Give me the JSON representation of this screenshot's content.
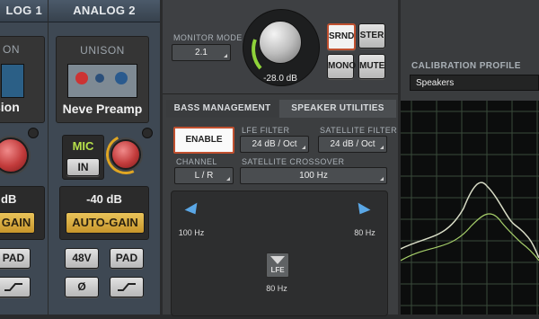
{
  "channels": {
    "left": {
      "name": "LOG 1",
      "insert_label": "ON",
      "insert_name": "sion",
      "gain": "dB",
      "autogain": "GAIN",
      "pad": "PAD"
    },
    "right": {
      "name": "ANALOG 2",
      "insert_label": "UNISON",
      "insert_name": "Neve Preamp",
      "mic": "MIC",
      "in": "IN",
      "gain": "-40 dB",
      "autogain": "AUTO-GAIN",
      "phantom": "48V",
      "pad": "PAD",
      "phase": "Ø"
    }
  },
  "monitor": {
    "mode_label": "MONITOR MODE",
    "mode_value": "2.1",
    "level": "-28.0 dB",
    "buttons": [
      "SRND",
      "STER",
      "MONO",
      "MUTE"
    ]
  },
  "tabs": [
    "BASS MANAGEMENT",
    "SPEAKER UTILITIES"
  ],
  "bass": {
    "enable": "ENABLE",
    "lfe_filter_label": "LFE FILTER",
    "lfe_filter_value": "24 dB / Oct",
    "sat_filter_label": "SATELLITE FILTER",
    "sat_filter_value": "24 dB / Oct",
    "channel_label": "CHANNEL",
    "channel_value": "L / R",
    "crossover_label": "SATELLITE CROSSOVER",
    "crossover_value": "100 Hz"
  },
  "speakers": {
    "left_freq": "100 Hz",
    "right_freq": "80 Hz",
    "lfe_label": "LFE",
    "lfe_freq": "80 Hz"
  },
  "calibration": {
    "label": "CALIBRATION PROFILE",
    "value": "Speakers"
  }
}
